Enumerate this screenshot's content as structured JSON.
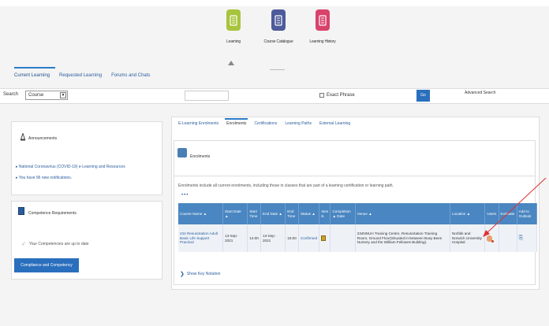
{
  "header": {
    "user_text": "",
    "apps": [
      {
        "label": "Learning",
        "color": "#a8c43c"
      },
      {
        "label": "Course Catalogue",
        "color": "#4d5b9a"
      },
      {
        "label": "Learning History",
        "color": "#d9426b"
      }
    ]
  },
  "tabs": [
    "Current Learning",
    "Requested Learning",
    "Forums and Chats"
  ],
  "search": {
    "label": "Search",
    "select_value": "Course",
    "exact_phrase": "Exact Phrase",
    "go": "Go",
    "advanced": "Advanced Search"
  },
  "announcements": {
    "title": "Announcements",
    "links": [
      "National Coronavirus (COVID-19) e-Learning and Resources",
      "You have 96 new notifications."
    ]
  },
  "competence": {
    "title": "Competence Requirements",
    "status": "Your Competencies are up to date",
    "button": "Compliance and Competency"
  },
  "subtabs": [
    "E-Learning Enrolments",
    "Enrolments",
    "Certifications",
    "Learning Paths",
    "External Learning"
  ],
  "enrolments": {
    "title": "Enrolments",
    "note": "Enrolments include all current enrolments, including those in classes that are part of a learning certification or learning path.",
    "more": "•••",
    "columns": [
      "Course Name ▲",
      "Start Date ▲",
      "Start Time",
      "End Date ▲",
      "End Time",
      "Status ▲",
      "Item ls",
      "Completion ▲ Date",
      "Venue ▲",
      "Location ▲",
      "Users",
      "Evaluate",
      "Add to Outlook"
    ],
    "rows": [
      {
        "course": "234 Resuscitation Adult Basic Life Support Practical",
        "start_date": "13-Sep-2021",
        "start_time": "14:00",
        "end_date": "13-Sep-2021",
        "end_time": "15:00",
        "status": "Confirmed",
        "venue": "234NNUH Training Centre, Resuscitation Training Room, Ground Floor(Situated in-between Busy Bees Nursery and the William Fellowes Building).",
        "location": "Norfolk and Norwich University Hospital"
      }
    ],
    "key_notation": "Show Key Notation"
  },
  "colors": {
    "accent": "#2a6fbd",
    "header_row": "#4a86c1",
    "arrow": "#e03030"
  }
}
